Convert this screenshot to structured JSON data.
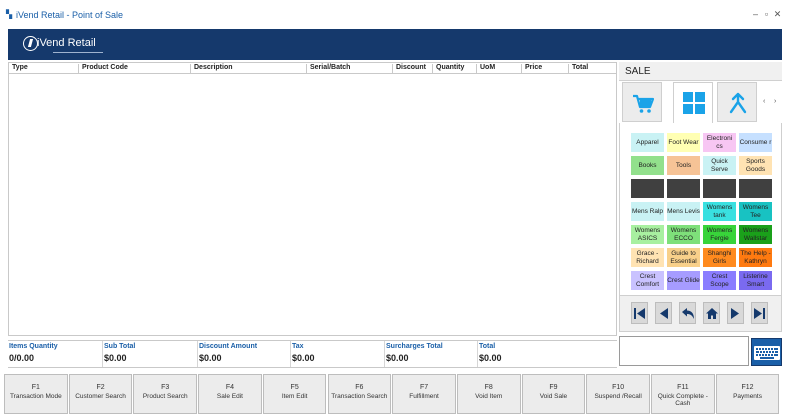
{
  "window": {
    "title": "iVend Retail - Point of Sale",
    "controls": [
      "–",
      "▫",
      "✕"
    ]
  },
  "header": {
    "brand": "iVend Retail"
  },
  "cart": {
    "columns": [
      "Type",
      "Product Code",
      "Description",
      "Serial/Batch",
      "Discount",
      "Quantity",
      "UoM",
      "Price",
      "Total"
    ]
  },
  "totals": [
    {
      "label": "Items Quantity",
      "value": "0/0.00"
    },
    {
      "label": "Sub Total",
      "value": "$0.00"
    },
    {
      "label": "Discount Amount",
      "value": "$0.00"
    },
    {
      "label": "Tax",
      "value": "$0.00"
    },
    {
      "label": "Surcharges Total",
      "value": "$0.00"
    },
    {
      "label": "Total",
      "value": "$0.00"
    }
  ],
  "side": {
    "heading": "SALE",
    "tabs": [
      {
        "icon": "cart-icon",
        "active": false
      },
      {
        "icon": "grid-icon",
        "active": true
      },
      {
        "icon": "merge-arrow-icon",
        "active": false
      }
    ],
    "scroll_left": "‹",
    "scroll_right": "›"
  },
  "tiles": [
    {
      "label": "Apparel",
      "color": "#c9f2f4"
    },
    {
      "label": "Foot Wear",
      "color": "#ffffb3"
    },
    {
      "label": "Electroni cs",
      "color": "#f7c6f3"
    },
    {
      "label": "Consume r",
      "color": "#c6e0ff"
    },
    {
      "label": "Books",
      "color": "#92e08c"
    },
    {
      "label": "Tools",
      "color": "#f6c396"
    },
    {
      "label": "Quick Serve",
      "color": "#c9f2f4"
    },
    {
      "label": "Sports Goods",
      "color": "#ffe3b3"
    },
    {
      "label": "",
      "color": "#404040"
    },
    {
      "label": "",
      "color": "#404040"
    },
    {
      "label": "",
      "color": "#404040"
    },
    {
      "label": "",
      "color": "#404040"
    },
    {
      "label": "Mens Ralp",
      "color": "#c9f2f4"
    },
    {
      "label": "Mens Levis",
      "color": "#c9f2f4"
    },
    {
      "label": "Womens tank",
      "color": "#39e0e0"
    },
    {
      "label": "Womens Tee",
      "color": "#18c2c2"
    },
    {
      "label": "Womens ASICS",
      "color": "#a8f0a0"
    },
    {
      "label": "Womens ECCO",
      "color": "#7ee07a"
    },
    {
      "label": "Womens Fergie",
      "color": "#38d43a"
    },
    {
      "label": "Womens Wallstar",
      "color": "#1aa01a"
    },
    {
      "label": "Grace - Richard",
      "color": "#ffe3b3"
    },
    {
      "label": "Guide to Essential",
      "color": "#f8d08a"
    },
    {
      "label": "Shanghi Girls",
      "color": "#ff8a1e"
    },
    {
      "label": "The Help - Kathryn",
      "color": "#ff7a10"
    },
    {
      "label": "Crest Comfort",
      "color": "#c9c2ff"
    },
    {
      "label": "Crest Glide",
      "color": "#a69cff"
    },
    {
      "label": "Crest Scope",
      "color": "#8a7dff"
    },
    {
      "label": "Listerine Smart",
      "color": "#7a6af0"
    }
  ],
  "function_keys": [
    {
      "key": "F1",
      "label": "Transaction Mode"
    },
    {
      "key": "F2",
      "label": "Customer Search"
    },
    {
      "key": "F3",
      "label": "Product Search"
    },
    {
      "key": "F4",
      "label": "Sale Edit"
    },
    {
      "key": "F5",
      "label": "Item Edit"
    },
    {
      "key": "F6",
      "label": "Transaction Search"
    },
    {
      "key": "F7",
      "label": "Fulfillment"
    },
    {
      "key": "F8",
      "label": "Void Item"
    },
    {
      "key": "F9",
      "label": "Void Sale"
    },
    {
      "key": "F10",
      "label": "Suspend /Recall"
    },
    {
      "key": "F11",
      "label": "Quick Complete - Cash"
    },
    {
      "key": "F12",
      "label": "Payments"
    }
  ],
  "colors": {
    "header_bg": "#15396c",
    "accent": "#1a5fa8",
    "nav_icon": "#15396c"
  }
}
